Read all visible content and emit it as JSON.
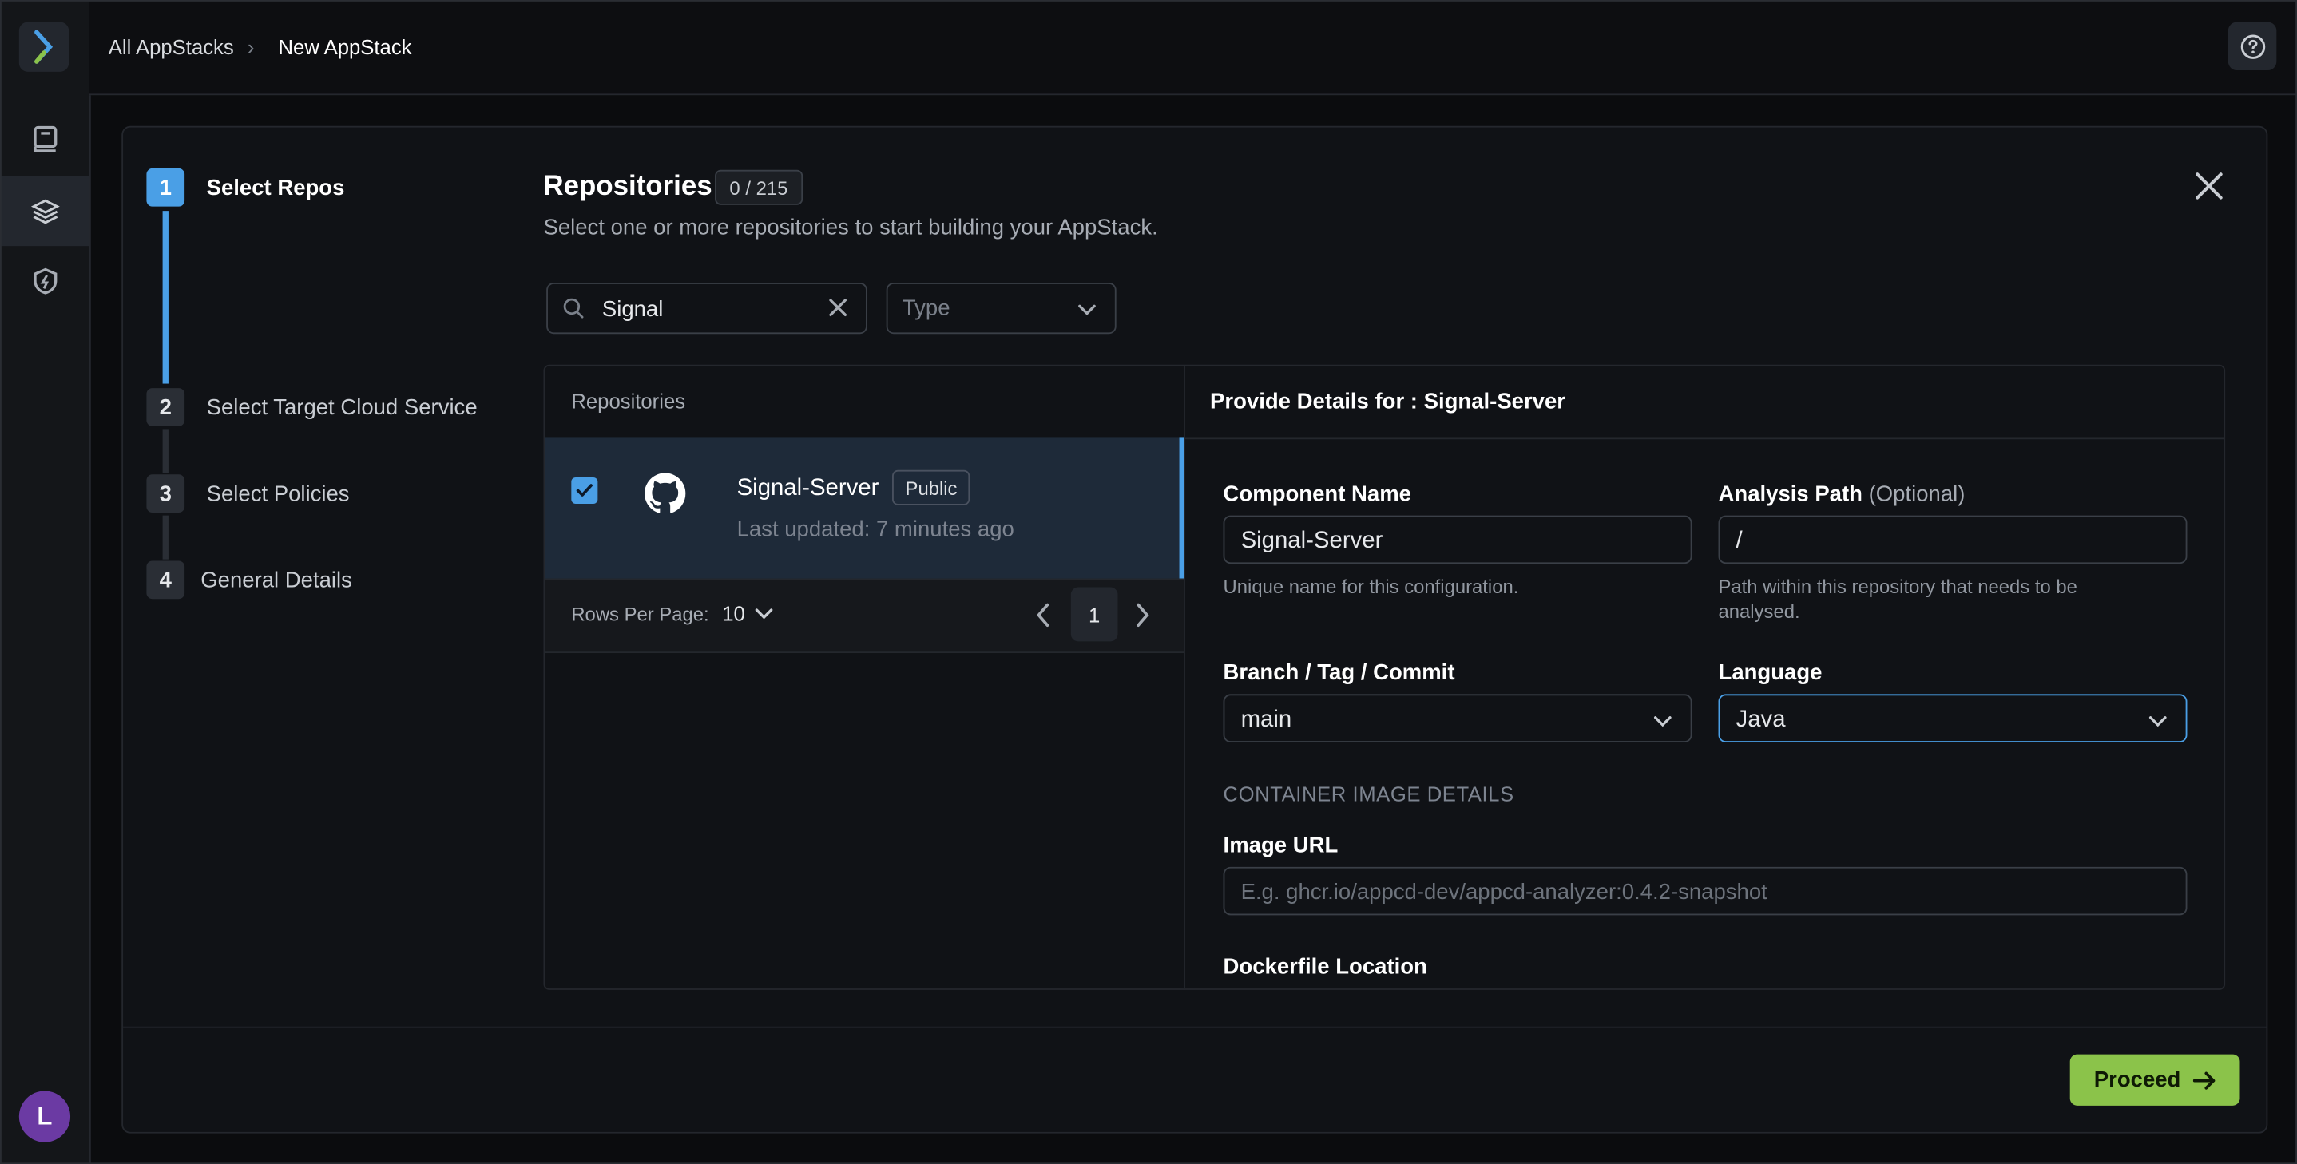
{
  "breadcrumb": {
    "parent": "All AppStacks",
    "separator": "›",
    "current": "New AppStack"
  },
  "user": {
    "avatar_initial": "L"
  },
  "colors": {
    "accent": "#4a9fe6",
    "proceed": "#8bc34a",
    "avatar": "#6b3aa3"
  },
  "steps": [
    {
      "number": "1",
      "label": "Select Repos",
      "active": true
    },
    {
      "number": "2",
      "label": "Select Target Cloud Service",
      "active": false
    },
    {
      "number": "3",
      "label": "Select Policies",
      "active": false
    },
    {
      "number": "4",
      "label": "General Details",
      "active": false
    }
  ],
  "repos": {
    "title": "Repositories",
    "count": "0 / 215",
    "subtitle": "Select one or more repositories to start building your AppStack.",
    "search_value": "Signal",
    "type_placeholder": "Type",
    "list_header": "Repositories",
    "items": [
      {
        "name": "Signal-Server",
        "visibility": "Public",
        "updated": "Last updated: 7 minutes ago",
        "checked": true
      }
    ],
    "rows_per_page_label": "Rows Per Page:",
    "rows_per_page": "10",
    "page": "1"
  },
  "details": {
    "header": "Provide Details for : Signal-Server",
    "component_name_label": "Component Name",
    "component_name_value": "Signal-Server",
    "component_name_help": "Unique name for this configuration.",
    "analysis_path_label": "Analysis Path",
    "analysis_path_optional": "(Optional)",
    "analysis_path_value": "/",
    "analysis_path_help": "Path within this repository that needs to be analysed.",
    "branch_label": "Branch / Tag / Commit",
    "branch_value": "main",
    "language_label": "Language",
    "language_value": "Java",
    "container_section": "CONTAINER IMAGE DETAILS",
    "image_url_label": "Image URL",
    "image_url_placeholder": "E.g. ghcr.io/appcd-dev/appcd-analyzer:0.4.2-snapshot",
    "dockerfile_label": "Dockerfile Location"
  },
  "footer": {
    "proceed_label": "Proceed"
  }
}
